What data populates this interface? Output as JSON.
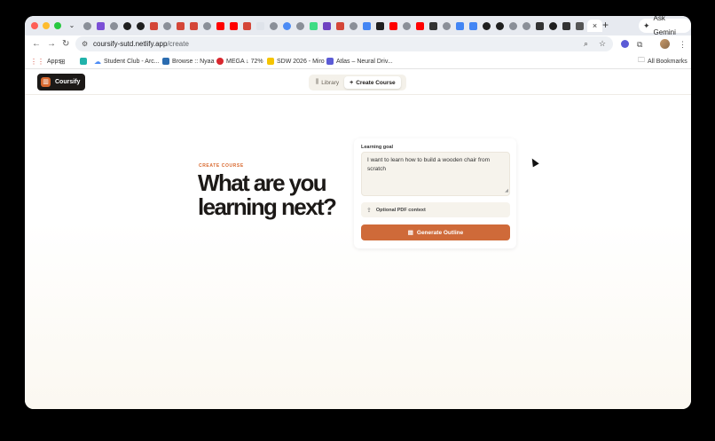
{
  "browser": {
    "tabs": [
      {
        "icon": "globe",
        "color": "#8a8f98"
      },
      {
        "icon": "twitch",
        "color": "#7b4fd6",
        "active": false
      },
      {
        "icon": "globe",
        "color": "#8a8f98"
      },
      {
        "icon": "notion",
        "color": "#1f1f1f"
      },
      {
        "icon": "notion",
        "color": "#1f1f1f"
      },
      {
        "icon": "gmail",
        "color": "#d44638"
      },
      {
        "icon": "globe",
        "color": "#8a8f98"
      },
      {
        "icon": "gmail",
        "color": "#d44638"
      },
      {
        "icon": "gmail",
        "color": "#d44638"
      },
      {
        "icon": "globe",
        "color": "#8a8f98"
      },
      {
        "icon": "youtube",
        "color": "#ff0000"
      },
      {
        "icon": "youtube",
        "color": "#ff0000"
      },
      {
        "icon": "gmail",
        "color": "#d44638"
      },
      {
        "icon": "blank",
        "color": "#dfe3ea"
      },
      {
        "icon": "globe",
        "color": "#8a8f98"
      },
      {
        "icon": "chrome",
        "color": "#4c8bf5"
      },
      {
        "icon": "globe",
        "color": "#8a8f98"
      },
      {
        "icon": "android",
        "color": "#3ddc84"
      },
      {
        "icon": "figma",
        "color": "#6f42c1"
      },
      {
        "icon": "gmail",
        "color": "#d44638"
      },
      {
        "icon": "globe",
        "color": "#8a8f98"
      },
      {
        "icon": "google",
        "color": "#4285f4"
      },
      {
        "icon": "cursor",
        "color": "#1f1f1f"
      },
      {
        "icon": "youtube",
        "color": "#ff0000"
      },
      {
        "icon": "globe",
        "color": "#8a8f98"
      },
      {
        "icon": "youtube",
        "color": "#ff0000"
      },
      {
        "icon": "unity",
        "color": "#333333"
      },
      {
        "icon": "globe",
        "color": "#8a8f98"
      },
      {
        "icon": "google",
        "color": "#4285f4"
      },
      {
        "icon": "google",
        "color": "#4285f4"
      },
      {
        "icon": "notion",
        "color": "#1f1f1f"
      },
      {
        "icon": "notion",
        "color": "#1f1f1f"
      },
      {
        "icon": "globe",
        "color": "#8a8f98"
      },
      {
        "icon": "globe",
        "color": "#8a8f98"
      },
      {
        "icon": "d-logo",
        "color": "#333333"
      },
      {
        "icon": "github",
        "color": "#1f1f1f"
      },
      {
        "icon": "d-logo",
        "color": "#333333"
      },
      {
        "icon": "openai",
        "color": "#555555"
      }
    ],
    "new_tab": "+",
    "gemini_label": "Ask Gemini",
    "url_host": "coursify-sutd.netlify.app",
    "url_path": "/create",
    "bookmarks": [
      {
        "label": "Apps",
        "color": "#d44638"
      },
      {
        "label": "",
        "color": "#555555"
      },
      {
        "label": "",
        "color": "#20b2aa"
      },
      {
        "label": "Student Club - Arc...",
        "color": "#4c8bf5"
      },
      {
        "label": "Browse :: Nyaa",
        "color": "#2b6cb0"
      },
      {
        "label": "MEGA ↓ 72%",
        "color": "#d9272e"
      },
      {
        "label": "SDW 2026 - Miro",
        "color": "#f5c400"
      },
      {
        "label": "Atlas – Neural Driv...",
        "color": "#5b5bd6"
      }
    ],
    "all_bookmarks": "All Bookmarks"
  },
  "app": {
    "brand": "Coursify",
    "nav": {
      "library": "Library",
      "create": "Create Course"
    }
  },
  "hero": {
    "eyebrow": "CREATE COURSE",
    "title_line1": "What are you",
    "title_line2": "learning next?"
  },
  "form": {
    "goal_label": "Learning goal",
    "goal_value": "I want to learn how to build a wooden chair from scratch",
    "pdf_label": "Optional PDF context",
    "submit_label": "Generate Outline"
  }
}
